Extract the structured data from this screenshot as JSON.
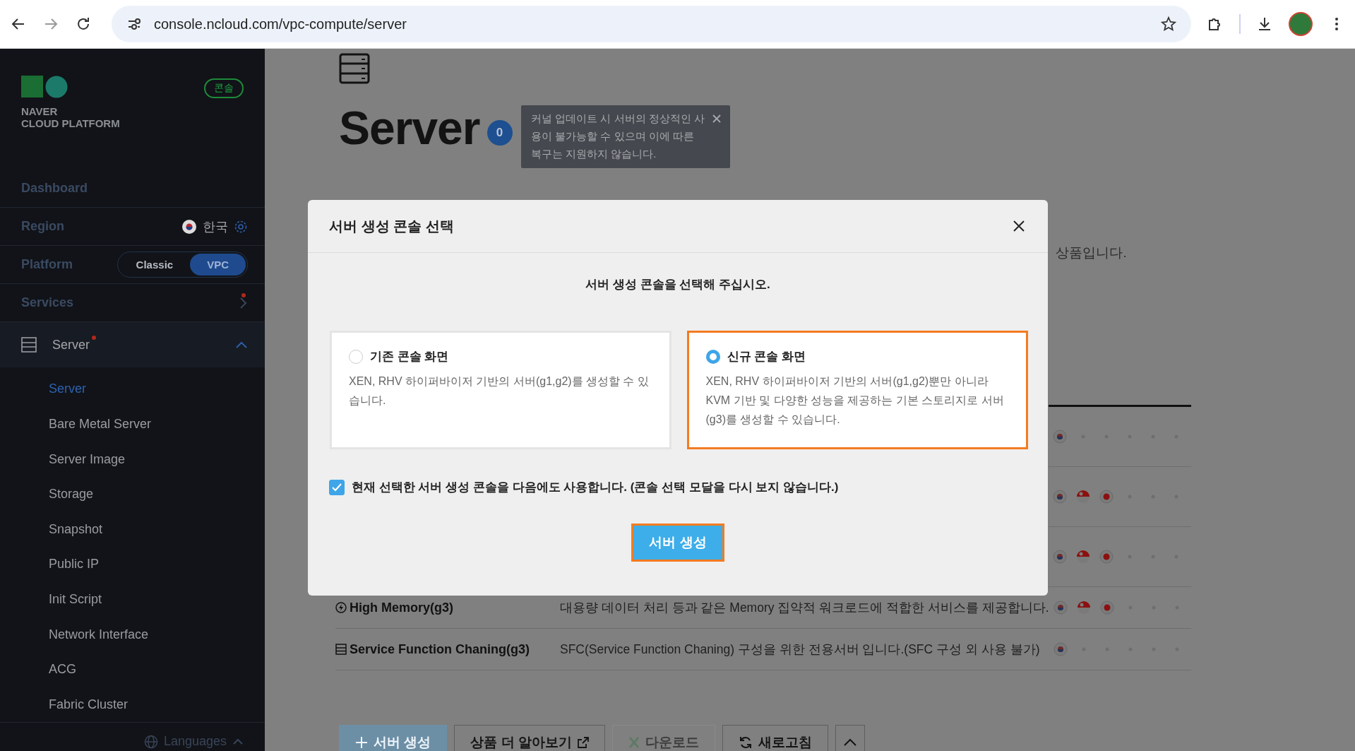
{
  "browser": {
    "url": "console.ncloud.com/vpc-compute/server"
  },
  "sidebar": {
    "logo": {
      "line1": "NAVER",
      "line2": "CLOUD PLATFORM"
    },
    "badge": "콘솔",
    "rows": [
      {
        "kind": "link",
        "label": "Dashboard"
      },
      {
        "kind": "region",
        "label": "Region",
        "value": "한국"
      },
      {
        "kind": "platform",
        "label": "Platform",
        "options": [
          {
            "label": "Classic",
            "selected": false
          },
          {
            "label": "VPC",
            "selected": true
          }
        ]
      },
      {
        "kind": "services",
        "label": "Services",
        "new": true
      }
    ],
    "group": {
      "label": "Server",
      "new": true,
      "expanded": true,
      "children": [
        {
          "label": "Server",
          "selected": true
        },
        {
          "label": "Bare Metal Server",
          "selected": false
        },
        {
          "label": "Server Image",
          "selected": false
        },
        {
          "label": "Storage",
          "selected": false
        },
        {
          "label": "Snapshot",
          "selected": false
        },
        {
          "label": "Public IP",
          "selected": false
        },
        {
          "label": "Init Script",
          "selected": false
        },
        {
          "label": "Network Interface",
          "selected": false
        },
        {
          "label": "ACG",
          "selected": false
        },
        {
          "label": "Fabric Cluster",
          "selected": false
        }
      ]
    },
    "footer": "Languages"
  },
  "page": {
    "title": "Server",
    "badge": "0",
    "tooltip": "커널 업데이트 시 서버의 정상적인 사용이 불가능할 수 있으며 이에 따른 복구는 지원하지 않습니다.",
    "description": "상품입니다.",
    "table": {
      "rows": [
        {
          "regions": [
            {
              "kind": "kr"
            },
            {
              "kind": "none"
            },
            {
              "kind": "none"
            },
            {
              "kind": "none"
            },
            {
              "kind": "none"
            },
            {
              "kind": "none"
            }
          ]
        },
        {
          "regions": [
            {
              "kind": "kr"
            },
            {
              "kind": "sg"
            },
            {
              "kind": "jp"
            },
            {
              "kind": "none"
            },
            {
              "kind": "none"
            },
            {
              "kind": "none"
            }
          ]
        },
        {
          "regions": [
            {
              "kind": "kr"
            },
            {
              "kind": "sg"
            },
            {
              "kind": "jp"
            },
            {
              "kind": "none"
            },
            {
              "kind": "none"
            },
            {
              "kind": "none"
            }
          ]
        },
        {
          "kind": "memory",
          "name": "High Memory(g3)",
          "description": "대용량 데이터 처리 등과 같은 Memory 집약적 워크로드에 적합한 서비스를 제공합니다.",
          "regions": [
            {
              "kind": "kr"
            },
            {
              "kind": "sg"
            },
            {
              "kind": "jp"
            },
            {
              "kind": "none"
            },
            {
              "kind": "none"
            },
            {
              "kind": "none"
            }
          ]
        },
        {
          "kind": "sfc",
          "name": "Service Function Chaning(g3)",
          "description": "SFC(Service Function Chaning) 구성을 위한 전용서버 입니다.(SFC 구성 외 사용 불가)",
          "regions": [
            {
              "kind": "kr"
            },
            {
              "kind": "none"
            },
            {
              "kind": "none"
            },
            {
              "kind": "none"
            },
            {
              "kind": "none"
            },
            {
              "kind": "none"
            }
          ]
        }
      ]
    },
    "buttons": [
      {
        "kind": "create",
        "label": "서버 생성",
        "disabled": true
      },
      {
        "kind": "external",
        "label": "상품 더 알아보기",
        "disabled": false
      },
      {
        "kind": "excel",
        "label": "다운로드",
        "disabled": true
      },
      {
        "kind": "refresh",
        "label": "새로고침",
        "disabled": false
      },
      {
        "kind": "collapse",
        "disabled": false
      }
    ]
  },
  "modal": {
    "title": "서버 생성 콘솔 선택",
    "prompt": "서버 생성 콘솔을 선택해 주십시오.",
    "options": [
      {
        "title": "기존 콘솔 화면",
        "text": "XEN, RHV 하이퍼바이저 기반의 서버(g1,g2)를 생성할 수 있습니다.",
        "selected": false
      },
      {
        "title": "신규 콘솔 화면",
        "text": "XEN, RHV 하이퍼바이저 기반의 서버(g1,g2)뿐만 아니라 KVM 기반 및 다양한 성능을 제공하는 기본 스토리지로 서버(g3)를 생성할 수 있습니다.",
        "selected": true
      }
    ],
    "remember": {
      "label": "현재 선택한 서버 생성 콘솔을 다음에도 사용합니다. (콘솔 선택 모달을 다시 보지 않습니다.)",
      "checked": true
    },
    "submit": "서버 생성"
  }
}
